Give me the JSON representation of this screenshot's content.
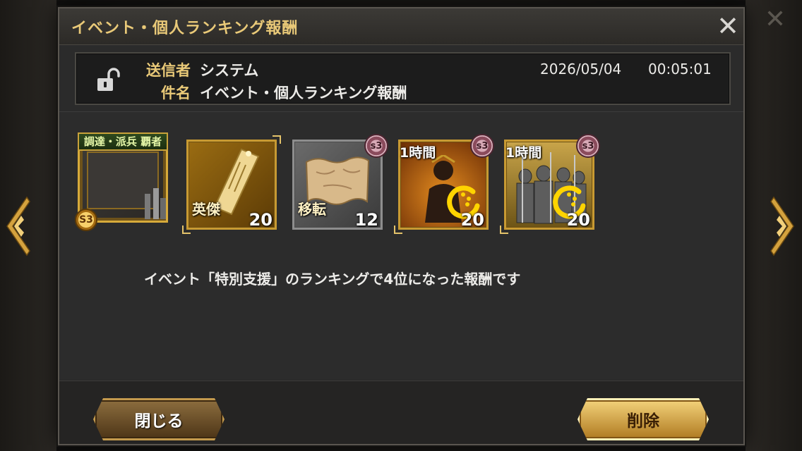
{
  "background": {
    "close_glyph": "✕"
  },
  "header": {
    "title": "イベント・個人ランキング報酬",
    "close_glyph": "✕"
  },
  "mail": {
    "sender_label": "送信者",
    "sender": "システム",
    "subject_label": "件名",
    "subject": "イベント・個人ランキング報酬",
    "date": "2026/05/04",
    "time": "00:05:01",
    "lock_icon": "unlocked-padlock-icon"
  },
  "rewards": [
    {
      "name": "title-frame",
      "banner": "調達・派兵 覇者",
      "season_badge": "S3",
      "icon": "trophy-frame-icon"
    },
    {
      "name": "hero-scroll",
      "label": "英傑",
      "count": "20",
      "icon": "scroll-icon"
    },
    {
      "name": "relocation-map",
      "label": "移転",
      "count": "12",
      "season_badge": "s3",
      "icon": "map-icon"
    },
    {
      "name": "speedup-general",
      "duration": "1時間",
      "count": "20",
      "season_badge": "s3",
      "icon": "refresh-icon"
    },
    {
      "name": "speedup-soldiers",
      "duration": "1時間",
      "count": "20",
      "season_badge": "s3",
      "icon": "refresh-icon"
    }
  ],
  "message": "イベント「特別支援」のランキングで4位になった報酬です",
  "buttons": {
    "close": "閉じる",
    "delete": "削除"
  },
  "colors": {
    "gold_text": "#e9c978",
    "panel": "#2b2b2b",
    "button_gold": "#f3d27a"
  }
}
